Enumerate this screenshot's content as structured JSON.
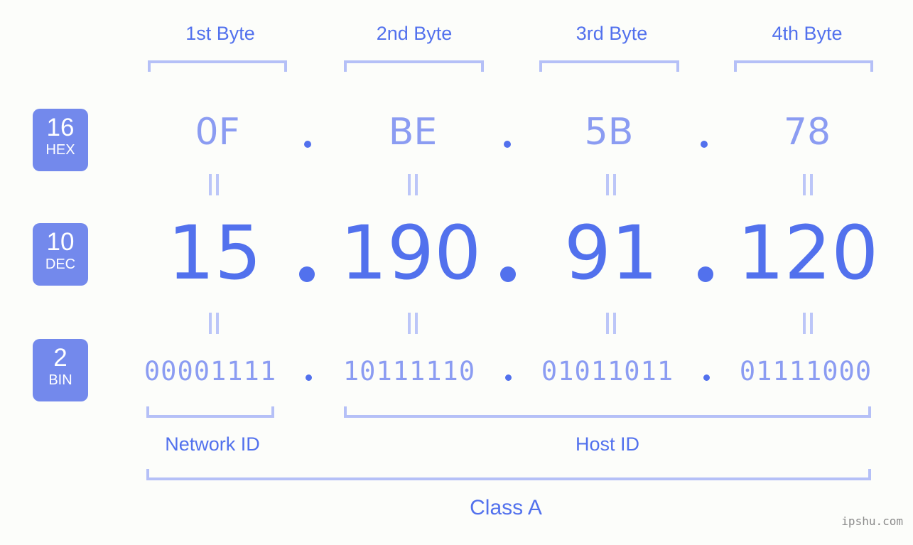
{
  "background_color": "#fcfdfa",
  "colors": {
    "accent_dark": "#5271ed",
    "accent_mid": "#8b9cf2",
    "accent_light": "#b5c0f7",
    "badge_bg": "#7389ec",
    "badge_text": "#ffffff",
    "watermark": "#8a8a8a"
  },
  "byte_headers": [
    {
      "label": "1st Byte"
    },
    {
      "label": "2nd Byte"
    },
    {
      "label": "3rd Byte"
    },
    {
      "label": "4th Byte"
    }
  ],
  "radix_badges": [
    {
      "number": "16",
      "label": "HEX"
    },
    {
      "number": "10",
      "label": "DEC"
    },
    {
      "number": "2",
      "label": "BIN"
    }
  ],
  "rows": {
    "hex": {
      "values": [
        "0F",
        "BE",
        "5B",
        "78"
      ],
      "separator": "."
    },
    "dec": {
      "values": [
        "15",
        "190",
        "91",
        "120"
      ],
      "separator": "."
    },
    "bin": {
      "values": [
        "00001111",
        "10111110",
        "01011011",
        "01111000"
      ],
      "separator": "."
    }
  },
  "equality_marks": {
    "glyph": "=",
    "count_per_row": 4
  },
  "id_labels": {
    "network": "Network ID",
    "host": "Host ID"
  },
  "class_label": "Class A",
  "watermark": "ipshu.com"
}
